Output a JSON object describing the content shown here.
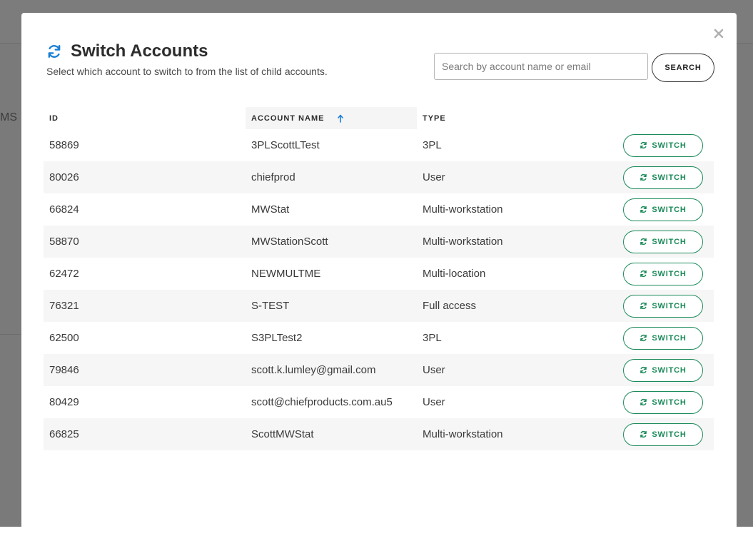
{
  "background": {
    "partial_text": "MS"
  },
  "modal": {
    "title": "Switch Accounts",
    "subtitle": "Select which account to switch to from the list of child accounts.",
    "close_icon": "close-icon",
    "title_icon": "refresh-icon"
  },
  "search": {
    "placeholder": "Search by account name or email",
    "value": "",
    "button_label": "SEARCH"
  },
  "table": {
    "columns": {
      "id": "ID",
      "name": "ACCOUNT NAME",
      "type": "TYPE"
    },
    "sort": {
      "column": "name",
      "direction": "ascending",
      "icon": "arrow-up-icon"
    },
    "rows": [
      {
        "id": "58869",
        "name": "3PLScottLTest",
        "type": "3PL",
        "action": "SWITCH"
      },
      {
        "id": "80026",
        "name": "chiefprod",
        "type": "User",
        "action": "SWITCH"
      },
      {
        "id": "66824",
        "name": "MWStat",
        "type": "Multi-workstation",
        "action": "SWITCH"
      },
      {
        "id": "58870",
        "name": "MWStationScott",
        "type": "Multi-workstation",
        "action": "SWITCH"
      },
      {
        "id": "62472",
        "name": "NEWMULTME",
        "type": "Multi-location",
        "action": "SWITCH"
      },
      {
        "id": "76321",
        "name": "S-TEST",
        "type": "Full access",
        "action": "SWITCH"
      },
      {
        "id": "62500",
        "name": "S3PLTest2",
        "type": "3PL",
        "action": "SWITCH"
      },
      {
        "id": "79846",
        "name": "scott.k.lumley@gmail.com",
        "type": "User",
        "action": "SWITCH"
      },
      {
        "id": "80429",
        "name": "scott@chiefproducts.com.au5",
        "type": "User",
        "action": "SWITCH"
      },
      {
        "id": "66825",
        "name": "ScottMWStat",
        "type": "Multi-workstation",
        "action": "SWITCH"
      }
    ]
  },
  "colors": {
    "accent_blue": "#1a7fd4",
    "switch_green": "#1b8a5a",
    "overlay": "#7a7a7a"
  }
}
